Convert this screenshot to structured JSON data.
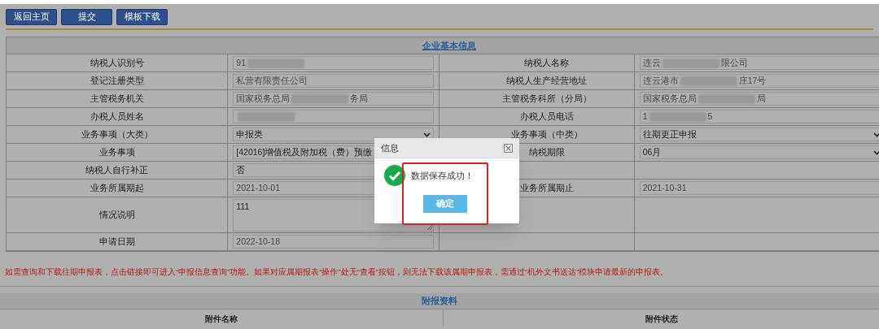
{
  "toolbar": {
    "buttons": [
      "返回主页",
      "提交",
      "模板下载"
    ]
  },
  "basic_info": {
    "title": "企业基本信息",
    "rows": [
      {
        "cells": [
          {
            "label": "纳税人识别号",
            "kind": "text",
            "value": "91",
            "redacted": true
          },
          {
            "label": "纳税人名称",
            "kind": "text",
            "value": "连云",
            "value_after": "限公司",
            "redacted": true
          }
        ]
      },
      {
        "cells": [
          {
            "label": "登记注册类型",
            "kind": "text",
            "value": "私营有限责任公司"
          },
          {
            "label": "纳税人生产经营地址",
            "kind": "text",
            "value": "连云港市",
            "value_after": "庄17号",
            "redacted": true
          }
        ]
      },
      {
        "cells": [
          {
            "label": "主管税务机关",
            "kind": "text",
            "value": "国家税务总局",
            "value_after": "务局",
            "redacted": true
          },
          {
            "label": "主管税务科所（分局）",
            "kind": "text",
            "value": "国家税务总局",
            "value_after": "局",
            "redacted": true
          }
        ]
      },
      {
        "cells": [
          {
            "label": "办税人员姓名",
            "kind": "text",
            "redacted": true
          },
          {
            "label": "办税人员电话",
            "kind": "text",
            "value": "1",
            "value_after": "5",
            "redacted": true
          }
        ]
      },
      {
        "cells": [
          {
            "label": "业务事项（大类）",
            "kind": "select",
            "value": "申报类"
          },
          {
            "label": "业务事项（中类）",
            "kind": "select",
            "value": "往期更正申报"
          }
        ]
      },
      {
        "cells": [
          {
            "label": "业务事项",
            "kind": "select",
            "value": "[42016]增值税及附加税（费）预缴",
            "show_arrow": false
          },
          {
            "label": "纳税期限",
            "kind": "select",
            "value": "06月"
          }
        ]
      },
      {
        "cells": [
          {
            "label": "纳税人自行补正",
            "kind": "plain",
            "value": "否"
          }
        ]
      },
      {
        "cells": [
          {
            "label": "业务所属期起",
            "kind": "text",
            "value": "2021-10-01"
          },
          {
            "label": "业务所属期止",
            "kind": "text",
            "value": "2021-10-31"
          }
        ]
      },
      {
        "tall": true,
        "cells": [
          {
            "label": "情况说明",
            "kind": "textarea",
            "value": "111"
          }
        ]
      },
      {
        "cells": [
          {
            "label": "申请日期",
            "kind": "text",
            "value": "2022-10-18"
          }
        ]
      }
    ]
  },
  "notice": "如需查询和下载往期申报表，点击链接即可进入“申报信息查询”功能。如果对应属期报表“操作”处无“查看”按钮，则无法下载该属期申报表，需通过“机外文书送达”模块申请最新的申报表。",
  "attachments": {
    "title": "附报资料",
    "columns": [
      "附件名称",
      "附件状态"
    ]
  },
  "dialog": {
    "title": "信息",
    "message": "数据保存成功！",
    "button": "确定",
    "highlighted": true
  }
}
